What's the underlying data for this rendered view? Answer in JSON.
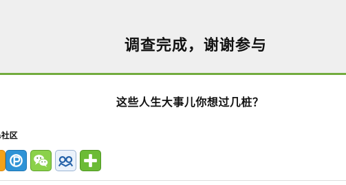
{
  "header": {
    "title": "调查完成，谢谢参与"
  },
  "survey": {
    "title": "这些人生大事儿你想过几桩？"
  },
  "share": {
    "label": "a社区",
    "buttons": [
      {
        "icon": "share-orange-icon"
      },
      {
        "icon": "share-p-icon"
      },
      {
        "icon": "wechat-icon"
      },
      {
        "icon": "share-m-icon"
      },
      {
        "icon": "plus-icon"
      }
    ]
  },
  "colors": {
    "header_bg": "#efefef",
    "divider": "#72ab3d",
    "text": "#111111"
  }
}
